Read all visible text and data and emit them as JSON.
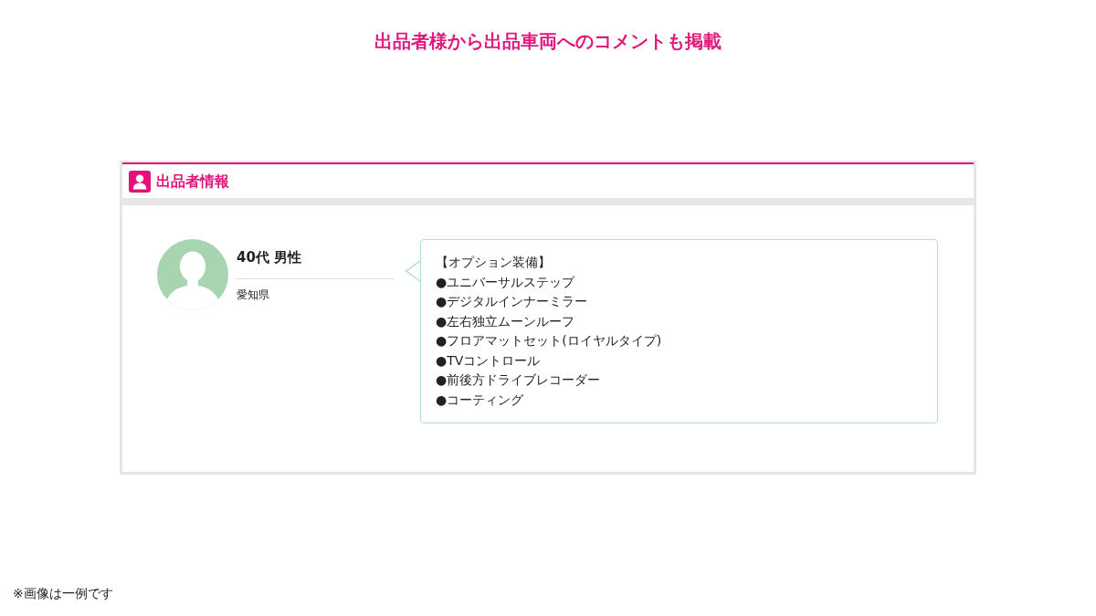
{
  "headline": "出品者様から出品車両へのコメントも掲載",
  "seller_panel": {
    "title": "出品者情報",
    "profile": {
      "name": "40代 男性",
      "location": "愛知県"
    },
    "comment": {
      "lines": [
        "【オプション装備】",
        "●ユニバーサルステップ",
        "●デジタルインナーミラー",
        "●左右独立ムーンルーフ",
        "●フロアマットセット(ロイヤルタイプ)",
        "●TVコントロール",
        "●前後方ドライブレコーダー",
        "●コーティング"
      ]
    }
  },
  "footnote": "※画像は一例です"
}
